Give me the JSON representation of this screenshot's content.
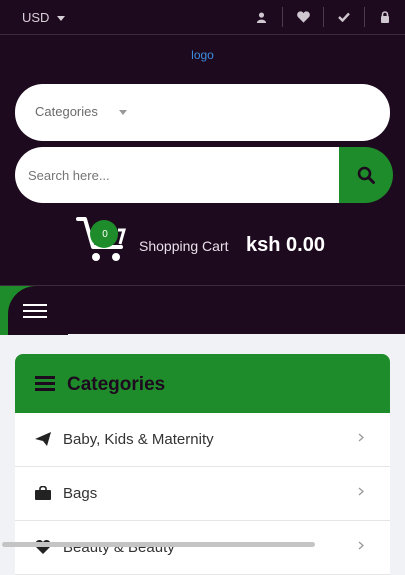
{
  "colors": {
    "header_bg": "#1e0a1e",
    "accent": "#1f8c2b",
    "logo": "#3b8de0"
  },
  "topbar": {
    "currency": "USD",
    "icons": [
      "user-icon",
      "heart-icon",
      "check-icon",
      "lock-icon"
    ]
  },
  "logo_text": "logo",
  "category_select": {
    "label": "Categories"
  },
  "search": {
    "placeholder": "Search here..."
  },
  "cart": {
    "count": "0",
    "label": "Shopping Cart",
    "total": "ksh 0.00"
  },
  "categories_panel": {
    "title": "Categories",
    "items": [
      {
        "label": "Baby, Kids & Maternity",
        "icon": "paper-plane-icon"
      },
      {
        "label": "Bags",
        "icon": "shopping-bag-icon"
      },
      {
        "label": "Beauty & Beauty",
        "icon": "heart-beat-icon"
      }
    ]
  }
}
